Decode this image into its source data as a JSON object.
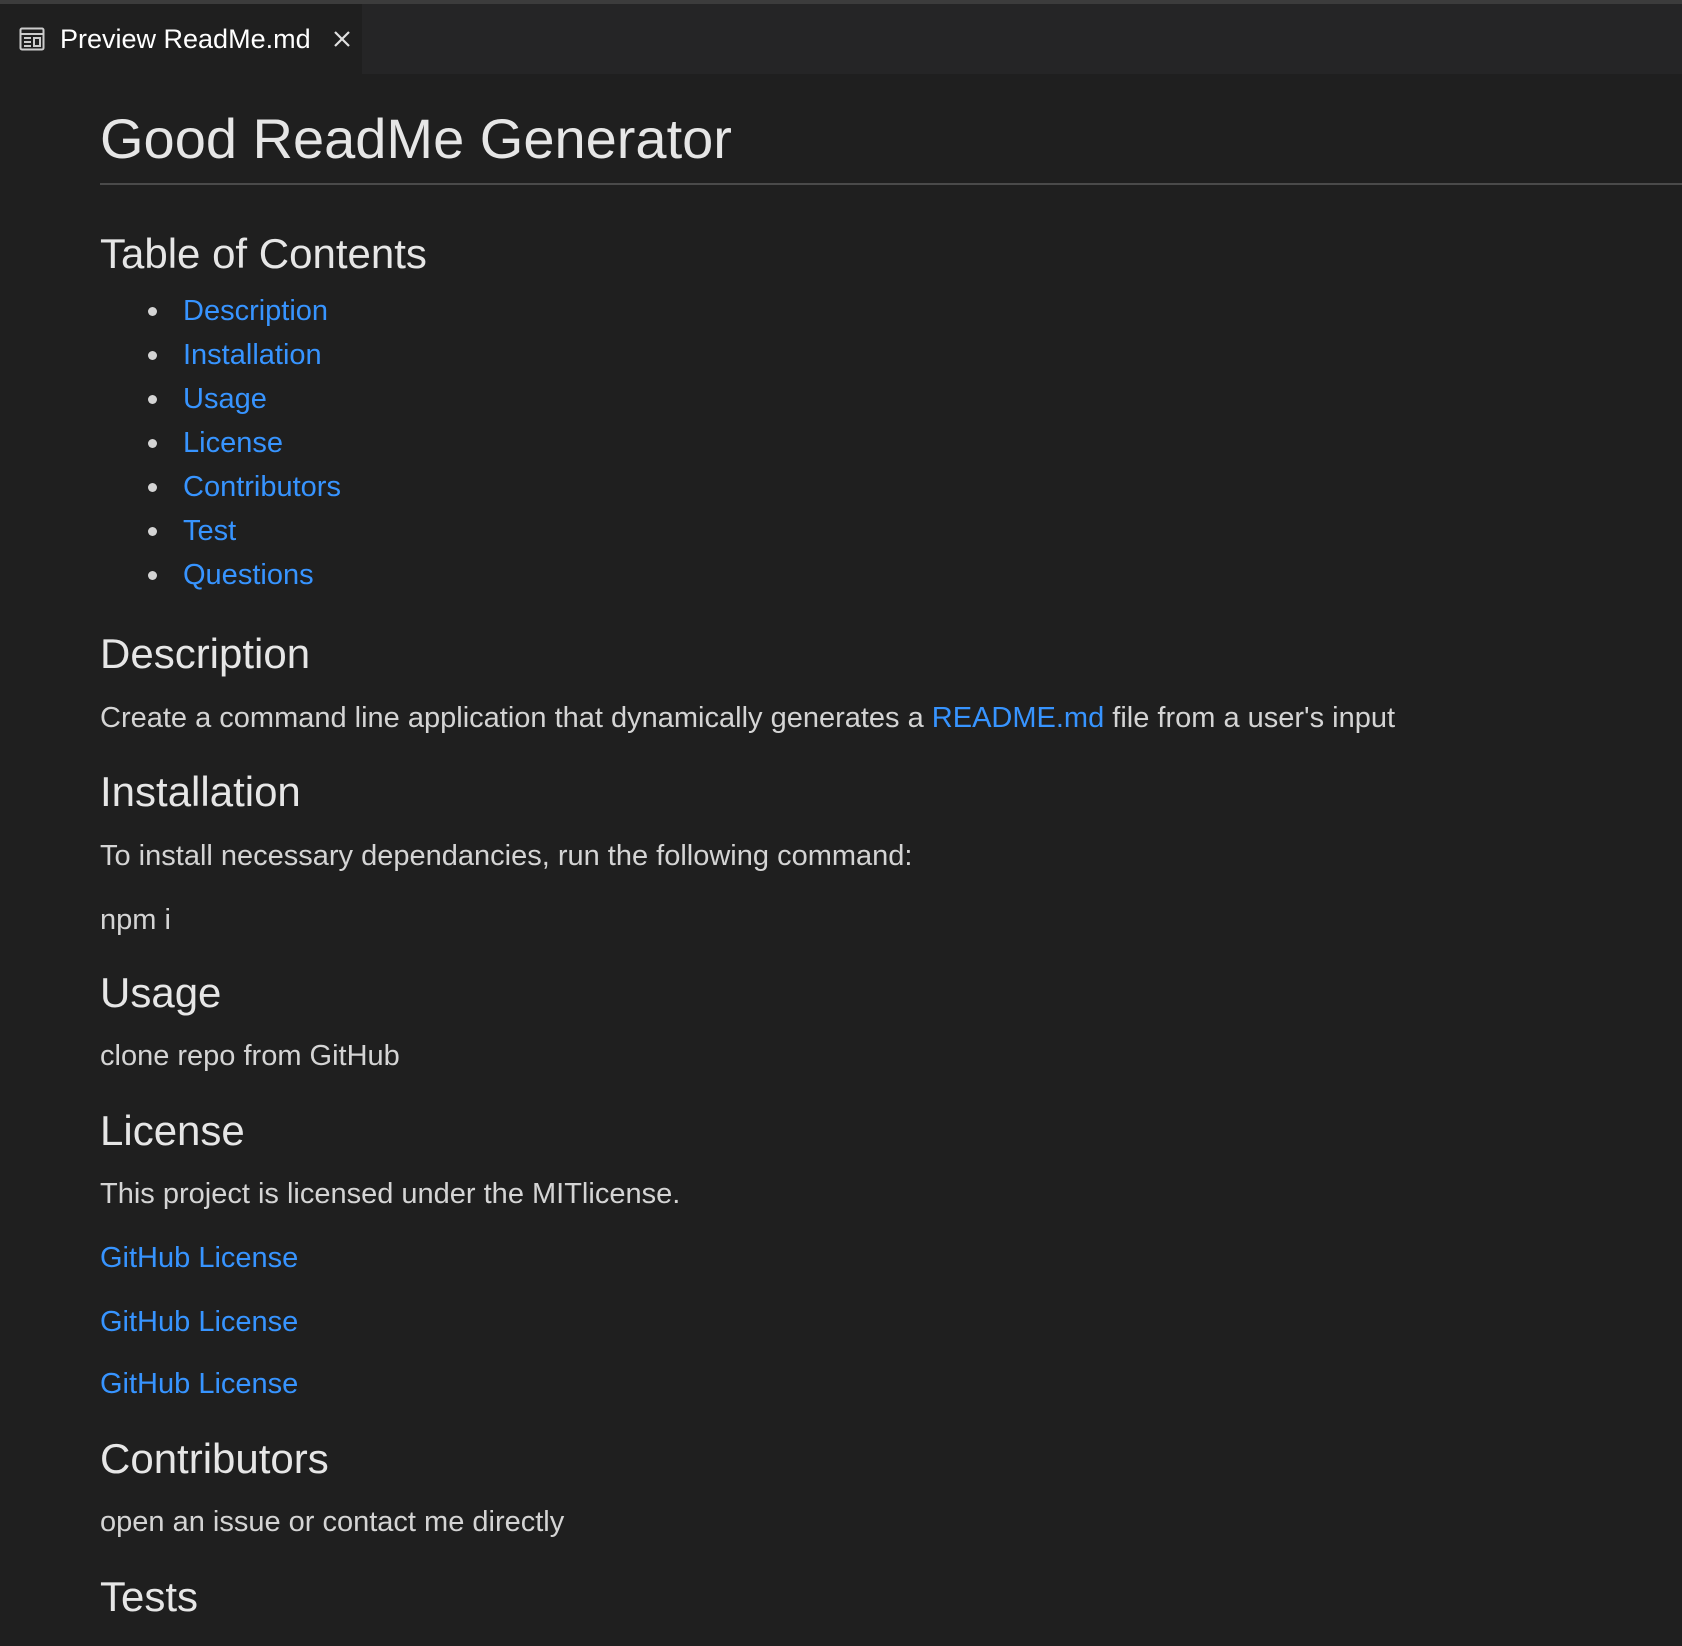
{
  "tab": {
    "icon": "preview-icon",
    "label": "Preview ReadMe.md",
    "close_icon": "close-icon"
  },
  "doc": {
    "title": "Good ReadMe Generator",
    "toc": {
      "heading": "Table of Contents",
      "items": [
        "Description",
        "Installation",
        "Usage",
        "License",
        "Contributors",
        "Test",
        "Questions"
      ]
    },
    "description": {
      "heading": "Description",
      "text_before": "Create a command line application that dynamically generates a ",
      "link": "README.md",
      "text_after": " file from a user's input"
    },
    "installation": {
      "heading": "Installation",
      "text": "To install necessary dependancies, run the following command:",
      "command": "npm i"
    },
    "usage": {
      "heading": "Usage",
      "text": "clone repo from GitHub"
    },
    "license": {
      "heading": "License",
      "text": "This project is licensed under the MITlicense.",
      "links": [
        "GitHub License",
        "GitHub License",
        "GitHub License"
      ]
    },
    "contributors": {
      "heading": "Contributors",
      "text": "open an issue or contact me directly"
    },
    "tests": {
      "heading": "Tests"
    }
  },
  "colors": {
    "background": "#1f1f1f",
    "link": "#3794ff",
    "text": "#d4d4d4",
    "heading": "#e6e6e6"
  }
}
